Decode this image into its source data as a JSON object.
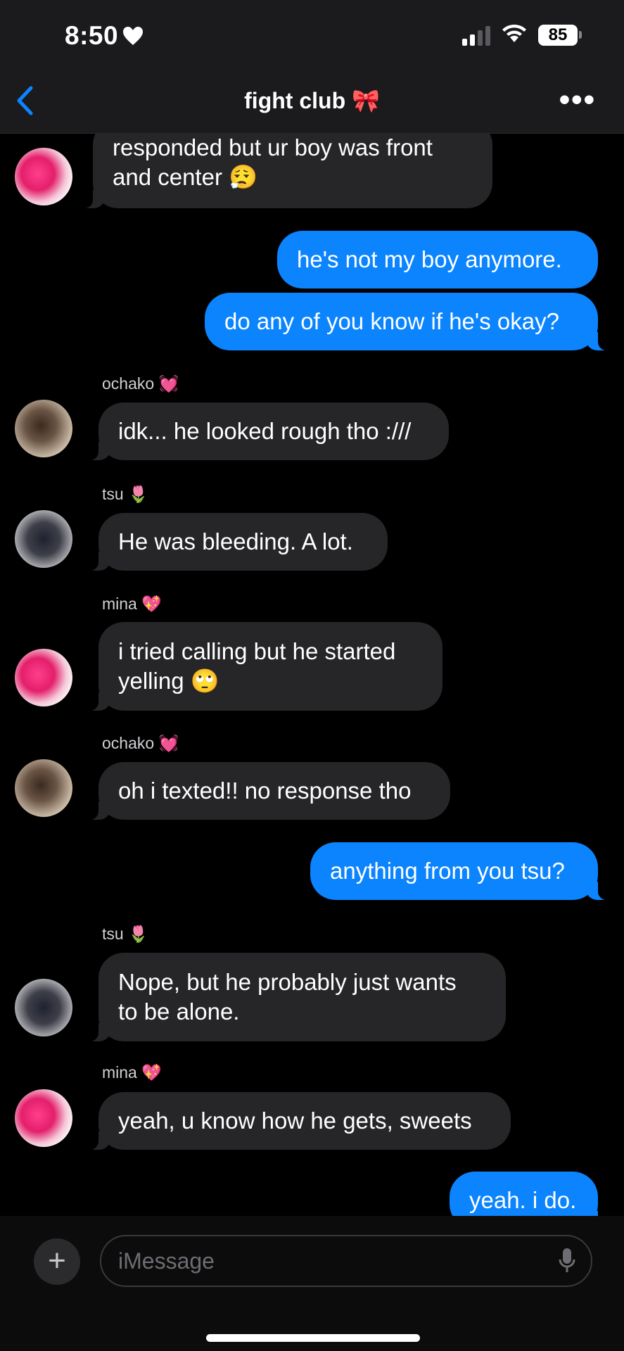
{
  "status_bar": {
    "time": "8:50",
    "battery": "85"
  },
  "nav": {
    "title": "fight club 🎀"
  },
  "messages": [
    {
      "dir": "in",
      "lines": [
        "responded but ur boy was front",
        "and center 😮‍💨"
      ]
    },
    {
      "dir": "out",
      "lines": [
        "he's not my boy anymore."
      ]
    },
    {
      "dir": "out",
      "lines": [
        "do any of you know if he's okay?"
      ]
    },
    {
      "dir": "in",
      "sender": "ochako 💓",
      "lines": [
        "idk... he looked rough tho :///"
      ]
    },
    {
      "dir": "in",
      "sender": "tsu 🌷",
      "lines": [
        "He was bleeding. A lot."
      ]
    },
    {
      "dir": "in",
      "sender": "mina 💖",
      "lines": [
        "i tried calling but he started",
        "yelling 🙄"
      ]
    },
    {
      "dir": "in",
      "sender": "ochako 💓",
      "lines": [
        "oh i texted!! no response tho"
      ]
    },
    {
      "dir": "out",
      "lines": [
        "anything from you tsu?"
      ]
    },
    {
      "dir": "in",
      "sender": "tsu 🌷",
      "lines": [
        "Nope, but he probably just wants",
        "to be alone."
      ]
    },
    {
      "dir": "in",
      "sender": "mina 💖",
      "lines": [
        "yeah, u know how he gets, sweets"
      ]
    },
    {
      "dir": "out",
      "lines": [
        "yeah. i do."
      ]
    }
  ],
  "composer": {
    "placeholder": "iMessage"
  },
  "icons": [
    "heart-icon",
    "signal-icon",
    "wifi-icon",
    "battery-icon",
    "back-chevron-icon",
    "more-icon",
    "plus-icon",
    "mic-icon"
  ],
  "colors": {
    "incoming": "#262628",
    "outgoing": "#0b84fe",
    "background": "#000000"
  }
}
